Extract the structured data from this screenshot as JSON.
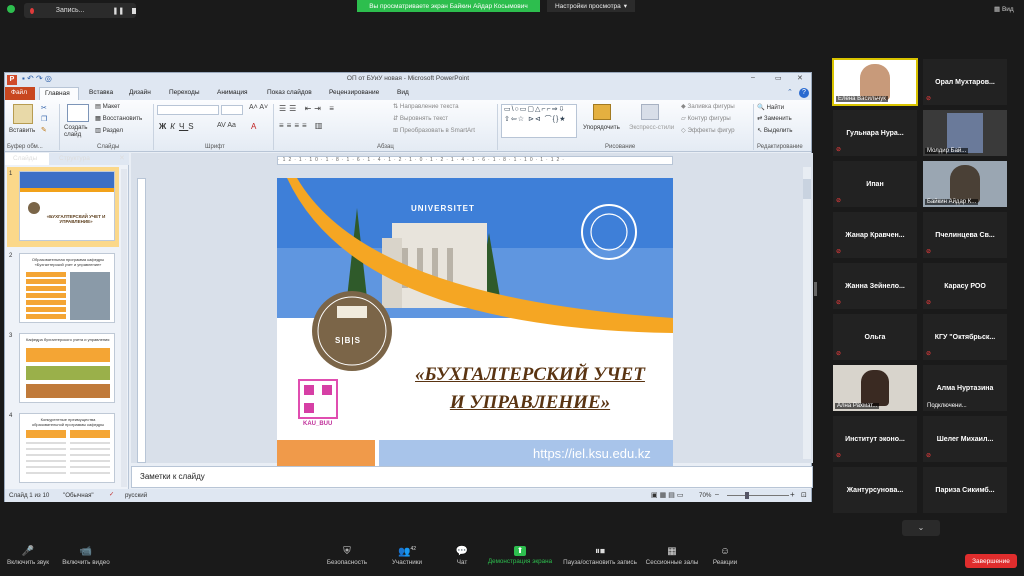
{
  "zoom": {
    "recording_label": "Запись...",
    "share_banner": "Вы просматриваете экран Байкин Айдар Косымович",
    "view_settings": "Настройки просмотра",
    "view_mode": "Вид",
    "end_button": "Завершение",
    "toolbar": [
      {
        "label": "Включить звук",
        "icon": "mic-muted-icon",
        "glyph": "🎤"
      },
      {
        "label": "Включить видео",
        "icon": "video-off-icon",
        "glyph": "📹"
      },
      {
        "label": "Безопасность",
        "icon": "shield-icon",
        "glyph": "⛨"
      },
      {
        "label": "Участники",
        "icon": "participants-icon",
        "glyph": "👥"
      },
      {
        "label": "Чат",
        "icon": "chat-icon",
        "glyph": "💬"
      },
      {
        "label": "Демонстрация экрана",
        "icon": "share-screen-icon",
        "glyph": "⬆"
      },
      {
        "label": "Пауза/остановить запись",
        "icon": "pause-record-icon",
        "glyph": "⏸"
      },
      {
        "label": "Сессионные залы",
        "icon": "breakout-rooms-icon",
        "glyph": "▦"
      },
      {
        "label": "Реакции",
        "icon": "reactions-icon",
        "glyph": "☺"
      }
    ],
    "participants_count": "42",
    "participants": [
      {
        "name": "Елена Васильчук",
        "video": true
      },
      {
        "name": "Орал  Мухтаров...",
        "video": false
      },
      {
        "name": "Гульнара  Нура...",
        "video": false
      },
      {
        "name": "Молдир Бай...",
        "video": true
      },
      {
        "name": "Ипан",
        "video": false
      },
      {
        "name": "Байкин Айдар К...",
        "video": true
      },
      {
        "name": "Жанар  Кравчен...",
        "video": false
      },
      {
        "name": "Пчелинцева  Св...",
        "video": false
      },
      {
        "name": "Жанна  Зейнело...",
        "video": false
      },
      {
        "name": "Карасу РОО",
        "video": false
      },
      {
        "name": "Ольга",
        "video": false
      },
      {
        "name": "КГУ  \"Октябрьск...",
        "video": false
      },
      {
        "name": "Ална Рахмат...",
        "video": true
      },
      {
        "name": "Алма  Нуртазина",
        "video": false
      },
      {
        "name": "Институт  эконо...",
        "video": false
      },
      {
        "name": "Шелег  Михаил...",
        "video": false
      },
      {
        "name": "Жантурсунова...",
        "video": false
      },
      {
        "name": "Париза  Сикимб...",
        "video": false
      }
    ],
    "connecting_label": "Подключени...",
    "accent_green": "#2dbe4e",
    "end_red": "#e02d2d"
  },
  "ppt": {
    "window_title": "ОП  от БУиУ новая  -  Microsoft PowerPoint",
    "tabs": [
      "Файл",
      "Главная",
      "Вставка",
      "Дизайн",
      "Переходы",
      "Анимация",
      "Показ слайдов",
      "Рецензирование",
      "Вид"
    ],
    "ribbon": {
      "paste": "Вставить",
      "create_slide": "Создать слайд",
      "layout": "Макет",
      "reset": "Восстановить",
      "section": "Раздел",
      "text_direction": "Направление текста",
      "align_text": "Выровнять текст",
      "smartart": "Преобразовать в SmartArt",
      "arrange": "Упорядочить",
      "quick_styles": "Экспресс-стили",
      "shape_fill": "Заливка фигуры",
      "shape_outline": "Контур фигуры",
      "shape_effects": "Эффекты фигур",
      "find": "Найти",
      "replace": "Заменить",
      "select": "Выделить",
      "groups": [
        "Буфер обм...",
        "Слайды",
        "Шрифт",
        "Абзац",
        "Рисование",
        "Редактирование"
      ]
    },
    "pane_tabs": [
      "Слайды",
      "Структура"
    ],
    "slide_numbers": [
      "1",
      "2",
      "3",
      "4"
    ],
    "thumb_texts": [
      "«БУХГАЛТЕРСКИЙ УЧЕТ И УПРАВЛЕНИЕ»",
      "Образовательная программа кафедры «Бухгалтерский учет и управление»",
      "Кафедра бухгалтерского учета и управления",
      "Конкурентные преимущества образовательной программы кафедры"
    ],
    "notes_placeholder": "Заметки к слайду",
    "status": {
      "slide": "Слайд 1 из 10",
      "theme": "\"Обычная\"",
      "lang": "русский",
      "zoom": "70%"
    },
    "slide": {
      "univ_sign": "UNIVERSITET",
      "logo_text": "S|B|S",
      "qr_caption": "KAU_BUU",
      "title_line1": "«БУХГАЛТЕРСКИЙ УЧЕТ",
      "title_line2": "И УПРАВЛЕНИЕ»",
      "url": "https://iel.ksu.edu.kz"
    }
  }
}
